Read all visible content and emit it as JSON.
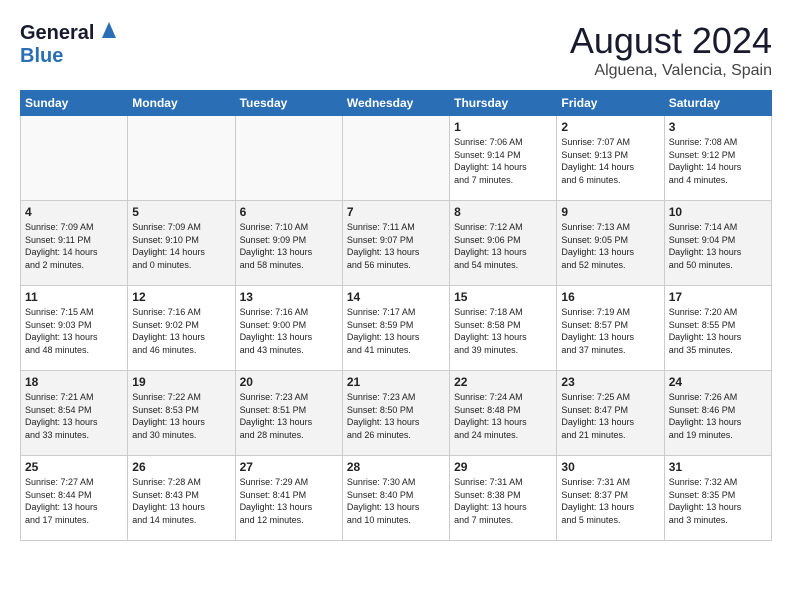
{
  "header": {
    "logo_line1": "General",
    "logo_line2": "Blue",
    "title": "August 2024",
    "subtitle": "Alguena, Valencia, Spain"
  },
  "weekdays": [
    "Sunday",
    "Monday",
    "Tuesday",
    "Wednesday",
    "Thursday",
    "Friday",
    "Saturday"
  ],
  "weeks": [
    {
      "days": [
        {
          "number": "",
          "info": "",
          "empty": true
        },
        {
          "number": "",
          "info": "",
          "empty": true
        },
        {
          "number": "",
          "info": "",
          "empty": true
        },
        {
          "number": "",
          "info": "",
          "empty": true
        },
        {
          "number": "1",
          "info": "Sunrise: 7:06 AM\nSunset: 9:14 PM\nDaylight: 14 hours\nand 7 minutes."
        },
        {
          "number": "2",
          "info": "Sunrise: 7:07 AM\nSunset: 9:13 PM\nDaylight: 14 hours\nand 6 minutes."
        },
        {
          "number": "3",
          "info": "Sunrise: 7:08 AM\nSunset: 9:12 PM\nDaylight: 14 hours\nand 4 minutes."
        }
      ]
    },
    {
      "days": [
        {
          "number": "4",
          "info": "Sunrise: 7:09 AM\nSunset: 9:11 PM\nDaylight: 14 hours\nand 2 minutes."
        },
        {
          "number": "5",
          "info": "Sunrise: 7:09 AM\nSunset: 9:10 PM\nDaylight: 14 hours\nand 0 minutes."
        },
        {
          "number": "6",
          "info": "Sunrise: 7:10 AM\nSunset: 9:09 PM\nDaylight: 13 hours\nand 58 minutes."
        },
        {
          "number": "7",
          "info": "Sunrise: 7:11 AM\nSunset: 9:07 PM\nDaylight: 13 hours\nand 56 minutes."
        },
        {
          "number": "8",
          "info": "Sunrise: 7:12 AM\nSunset: 9:06 PM\nDaylight: 13 hours\nand 54 minutes."
        },
        {
          "number": "9",
          "info": "Sunrise: 7:13 AM\nSunset: 9:05 PM\nDaylight: 13 hours\nand 52 minutes."
        },
        {
          "number": "10",
          "info": "Sunrise: 7:14 AM\nSunset: 9:04 PM\nDaylight: 13 hours\nand 50 minutes."
        }
      ]
    },
    {
      "days": [
        {
          "number": "11",
          "info": "Sunrise: 7:15 AM\nSunset: 9:03 PM\nDaylight: 13 hours\nand 48 minutes."
        },
        {
          "number": "12",
          "info": "Sunrise: 7:16 AM\nSunset: 9:02 PM\nDaylight: 13 hours\nand 46 minutes."
        },
        {
          "number": "13",
          "info": "Sunrise: 7:16 AM\nSunset: 9:00 PM\nDaylight: 13 hours\nand 43 minutes."
        },
        {
          "number": "14",
          "info": "Sunrise: 7:17 AM\nSunset: 8:59 PM\nDaylight: 13 hours\nand 41 minutes."
        },
        {
          "number": "15",
          "info": "Sunrise: 7:18 AM\nSunset: 8:58 PM\nDaylight: 13 hours\nand 39 minutes."
        },
        {
          "number": "16",
          "info": "Sunrise: 7:19 AM\nSunset: 8:57 PM\nDaylight: 13 hours\nand 37 minutes."
        },
        {
          "number": "17",
          "info": "Sunrise: 7:20 AM\nSunset: 8:55 PM\nDaylight: 13 hours\nand 35 minutes."
        }
      ]
    },
    {
      "days": [
        {
          "number": "18",
          "info": "Sunrise: 7:21 AM\nSunset: 8:54 PM\nDaylight: 13 hours\nand 33 minutes."
        },
        {
          "number": "19",
          "info": "Sunrise: 7:22 AM\nSunset: 8:53 PM\nDaylight: 13 hours\nand 30 minutes."
        },
        {
          "number": "20",
          "info": "Sunrise: 7:23 AM\nSunset: 8:51 PM\nDaylight: 13 hours\nand 28 minutes."
        },
        {
          "number": "21",
          "info": "Sunrise: 7:23 AM\nSunset: 8:50 PM\nDaylight: 13 hours\nand 26 minutes."
        },
        {
          "number": "22",
          "info": "Sunrise: 7:24 AM\nSunset: 8:48 PM\nDaylight: 13 hours\nand 24 minutes."
        },
        {
          "number": "23",
          "info": "Sunrise: 7:25 AM\nSunset: 8:47 PM\nDaylight: 13 hours\nand 21 minutes."
        },
        {
          "number": "24",
          "info": "Sunrise: 7:26 AM\nSunset: 8:46 PM\nDaylight: 13 hours\nand 19 minutes."
        }
      ]
    },
    {
      "days": [
        {
          "number": "25",
          "info": "Sunrise: 7:27 AM\nSunset: 8:44 PM\nDaylight: 13 hours\nand 17 minutes."
        },
        {
          "number": "26",
          "info": "Sunrise: 7:28 AM\nSunset: 8:43 PM\nDaylight: 13 hours\nand 14 minutes."
        },
        {
          "number": "27",
          "info": "Sunrise: 7:29 AM\nSunset: 8:41 PM\nDaylight: 13 hours\nand 12 minutes."
        },
        {
          "number": "28",
          "info": "Sunrise: 7:30 AM\nSunset: 8:40 PM\nDaylight: 13 hours\nand 10 minutes."
        },
        {
          "number": "29",
          "info": "Sunrise: 7:31 AM\nSunset: 8:38 PM\nDaylight: 13 hours\nand 7 minutes."
        },
        {
          "number": "30",
          "info": "Sunrise: 7:31 AM\nSunset: 8:37 PM\nDaylight: 13 hours\nand 5 minutes."
        },
        {
          "number": "31",
          "info": "Sunrise: 7:32 AM\nSunset: 8:35 PM\nDaylight: 13 hours\nand 3 minutes."
        }
      ]
    }
  ]
}
